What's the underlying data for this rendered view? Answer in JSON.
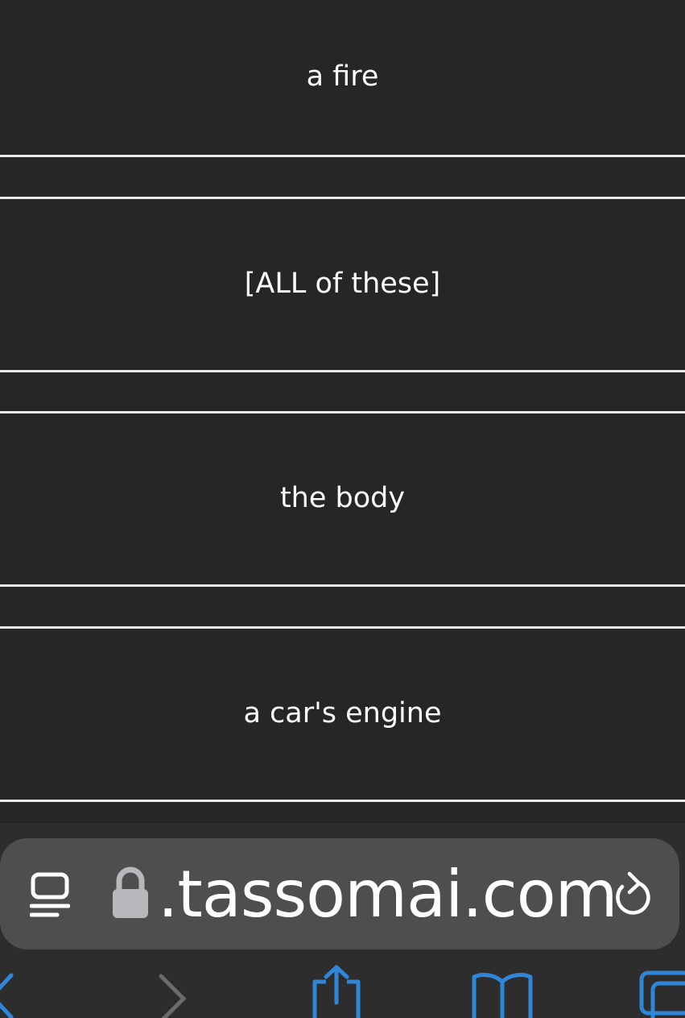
{
  "answers": [
    {
      "label": "a fire"
    },
    {
      "label": "[ALL of these]"
    },
    {
      "label": "the body"
    },
    {
      "label": "a car's engine"
    }
  ],
  "browser": {
    "url_text": ".tassomai.com",
    "icons": {
      "reader": "reader-mode-icon",
      "lock": "lock-icon",
      "reload": "reload-icon",
      "back": "back-chevron-icon",
      "forward": "forward-chevron-icon",
      "share": "share-icon",
      "bookmarks": "bookmarks-icon",
      "tabs": "tabs-icon"
    },
    "colors": {
      "accent": "#2f86d8",
      "field": "#4e4e4e",
      "background": "#262626"
    }
  }
}
